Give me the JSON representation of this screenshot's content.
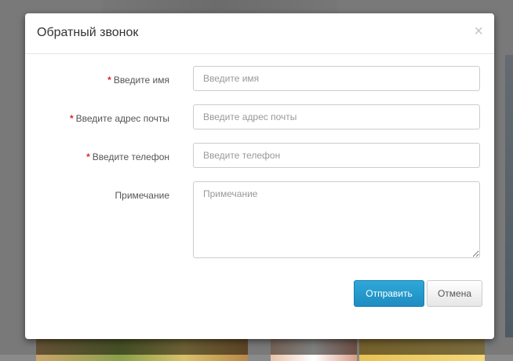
{
  "modal": {
    "title": "Обратный звонок",
    "close_symbol": "×"
  },
  "form": {
    "name": {
      "required_mark": "*",
      "label": "Введите имя",
      "placeholder": "Введите имя"
    },
    "email": {
      "required_mark": "*",
      "label": "Введите адрес почты",
      "placeholder": "Введите адрес почты"
    },
    "phone": {
      "required_mark": "*",
      "label": "Введите телефон",
      "placeholder": "Введите телефон"
    },
    "note": {
      "label": "Примечание",
      "placeholder": "Примечание"
    }
  },
  "buttons": {
    "submit_label": "Отправить",
    "cancel_label": "Отмена"
  },
  "colors": {
    "primary": "#1e8cc1",
    "required": "#d9262c"
  }
}
